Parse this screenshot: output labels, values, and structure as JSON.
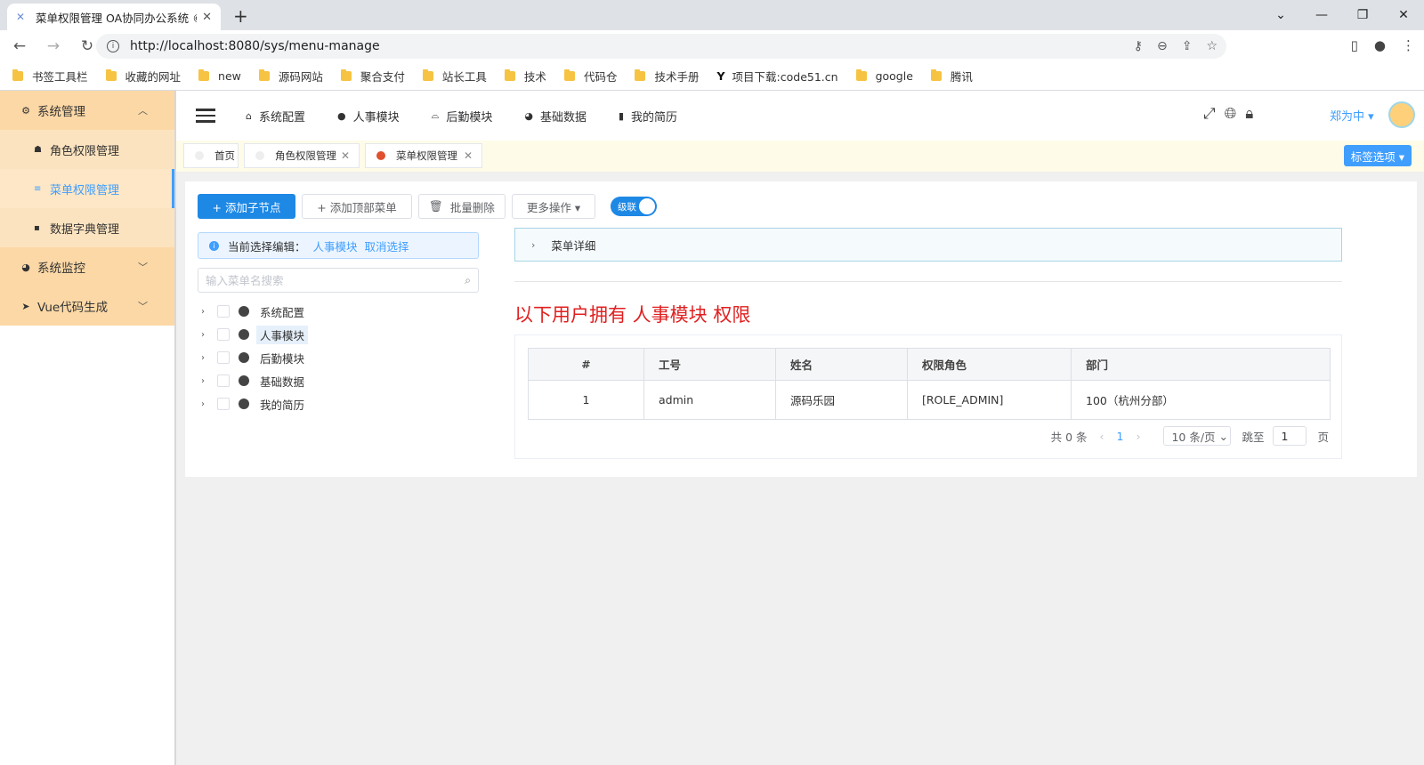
{
  "browser": {
    "tab_title": "菜单权限管理 OA协同办公系统 ©",
    "url": "http://localhost:8080/sys/menu-manage",
    "bookmarks": [
      "书签工具栏",
      "收藏的网址",
      "new",
      "源码网站",
      "聚合支付",
      "站长工具",
      "技术",
      "代码仓",
      "技术手册",
      "项目下载:code51.cn",
      "google",
      "腾讯"
    ]
  },
  "sidebar": {
    "groups": [
      {
        "label": "系统管理",
        "icon": "gear-icon",
        "expanded": true
      },
      {
        "label": "系统监控",
        "icon": "pie-icon",
        "expanded": false
      },
      {
        "label": "Vue代码生成",
        "icon": "send-icon",
        "expanded": false
      }
    ],
    "items": [
      {
        "label": "角色权限管理",
        "icon": "users-icon"
      },
      {
        "label": "菜单权限管理",
        "icon": "list-icon",
        "active": true
      },
      {
        "label": "数据字典管理",
        "icon": "book-icon"
      }
    ]
  },
  "header": {
    "menus": [
      {
        "label": "系统配置",
        "icon": "home-icon"
      },
      {
        "label": "人事模块",
        "icon": "pencil-icon"
      },
      {
        "label": "后勤模块",
        "icon": "basket-icon"
      },
      {
        "label": "基础数据",
        "icon": "pie-icon"
      },
      {
        "label": "我的简历",
        "icon": "book-icon"
      }
    ],
    "user": "郑为中 ▾"
  },
  "tags": {
    "items": [
      "首页",
      "角色权限管理",
      "菜单权限管理"
    ],
    "options_label": "标签选项 ▾"
  },
  "toolbar": {
    "add_child": "+ 添加子节点",
    "add_top": "+ 添加顶部菜单",
    "batch_delete": "批量删除",
    "more": "更多操作 ▾",
    "cascade": "级联"
  },
  "alert": {
    "prefix": "当前选择编辑：",
    "selected": "人事模块",
    "cancel": "取消选择"
  },
  "search": {
    "placeholder": "输入菜单名搜索"
  },
  "tree": [
    "系统配置",
    "人事模块",
    "后勤模块",
    "基础数据",
    "我的简历"
  ],
  "detail": {
    "label": "菜单详细"
  },
  "permission": {
    "title": "以下用户拥有 人事模块 权限"
  },
  "table": {
    "headers": [
      "#",
      "工号",
      "姓名",
      "权限角色",
      "部门"
    ],
    "rows": [
      [
        "1",
        "admin",
        "源码乐园",
        "[ROLE_ADMIN]",
        "100（杭州分部）"
      ]
    ]
  },
  "pager": {
    "total": "共 0 条",
    "page": "1",
    "size": "10 条/页",
    "goto": "跳至",
    "goto_value": "1",
    "page_unit": "页"
  }
}
